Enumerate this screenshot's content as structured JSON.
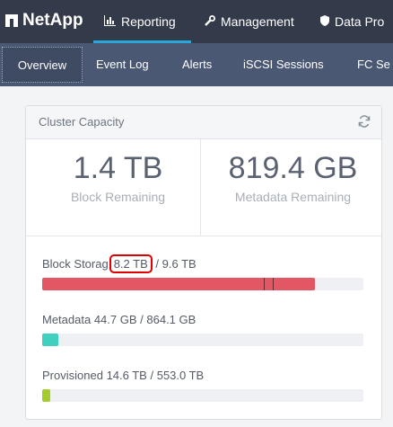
{
  "brand": {
    "name": "NetApp"
  },
  "topnav": [
    {
      "label": "Reporting",
      "icon": "bar-chart-icon"
    },
    {
      "label": "Management",
      "icon": "wrench-icon"
    },
    {
      "label": "Data Pro",
      "icon": "shield-icon"
    }
  ],
  "subnav": [
    {
      "label": "Overview"
    },
    {
      "label": "Event Log"
    },
    {
      "label": "Alerts"
    },
    {
      "label": "iSCSI Sessions"
    },
    {
      "label": "FC Se"
    }
  ],
  "card": {
    "title": "Cluster Capacity",
    "stats": [
      {
        "value": "1.4 TB",
        "label": "Block Remaining"
      },
      {
        "value": "819.4 GB",
        "label": "Metadata Remaining"
      }
    ],
    "metrics": {
      "block": {
        "label": "Block Storag",
        "used": "8.2 TB",
        "total": "/ 9.6 TB",
        "fill_pct": 85,
        "color": "#e35664"
      },
      "metadata": {
        "label": "Metadata",
        "used": "44.7 GB",
        "total": "/ 864.1 GB",
        "fill_pct": 5,
        "color": "#3fd0c0"
      },
      "provisioned": {
        "label": "Provisioned",
        "used": "14.6 TB",
        "total": "/ 553.0 TB",
        "fill_pct": 2.6,
        "color": "#a4cc2f"
      }
    }
  },
  "colors": {
    "topbar": "#333a49",
    "subbar": "#4b5873",
    "accent": "#2aa6d8"
  }
}
